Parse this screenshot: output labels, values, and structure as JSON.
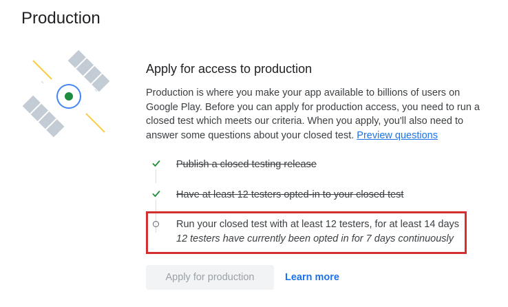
{
  "page": {
    "title": "Production"
  },
  "section": {
    "heading": "Apply for access to production",
    "description": "Production is where you make your app available to billions of users on Google Play. Before you can apply for production access, you need to run a closed test which meets our criteria. When you apply, you'll also need to answer some questions about your closed test.",
    "preview_link": "Preview questions"
  },
  "checklist": {
    "items": [
      {
        "label": "Publish a closed testing release",
        "status": "complete"
      },
      {
        "label": "Have at least 12 testers opted-in to your closed test",
        "status": "complete"
      }
    ],
    "current": {
      "label": "Run your closed test with at least 12 testers, for at least 14 days",
      "detail": "12 testers have currently been opted in for 7 days continuously",
      "status": "in-progress"
    }
  },
  "actions": {
    "apply_label": "Apply for production",
    "apply_disabled": true,
    "learn_more_label": "Learn more"
  },
  "colors": {
    "accent": "#1a73e8",
    "check_green": "#1e8e3e",
    "highlight_red": "#d32f2f"
  }
}
